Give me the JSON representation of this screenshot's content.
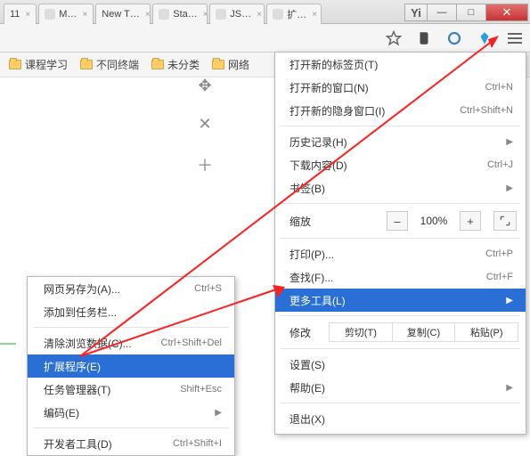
{
  "tabs": [
    {
      "label": "11"
    },
    {
      "label": "M…"
    },
    {
      "label": "New T…"
    },
    {
      "label": "Sta…"
    },
    {
      "label": "JS…"
    },
    {
      "label": "扩…"
    }
  ],
  "window": {
    "logo": "Yi",
    "min": "—",
    "max": "□",
    "close": "✕"
  },
  "bookmarks": [
    {
      "label": "课程学习"
    },
    {
      "label": "不同终端"
    },
    {
      "label": "未分类"
    },
    {
      "label": "网络"
    }
  ],
  "menu": {
    "new_tab": {
      "label": "打开新的标签页(T)",
      "sc": ""
    },
    "new_win": {
      "label": "打开新的窗口(N)",
      "sc": "Ctrl+N"
    },
    "incog": {
      "label": "打开新的隐身窗口(I)",
      "sc": "Ctrl+Shift+N"
    },
    "history": {
      "label": "历史记录(H)",
      "sc": ""
    },
    "downloads": {
      "label": "下载内容(D)",
      "sc": "Ctrl+J"
    },
    "bookmarks": {
      "label": "书签(B)",
      "sc": ""
    },
    "zoom": {
      "label": "缩放",
      "minus": "–",
      "val": "100%",
      "plus": "+"
    },
    "print": {
      "label": "打印(P)...",
      "sc": "Ctrl+P"
    },
    "find": {
      "label": "查找(F)...",
      "sc": "Ctrl+F"
    },
    "more_tools": {
      "label": "更多工具(L)",
      "sc": ""
    },
    "edit": {
      "label": "修改",
      "cut": "剪切(T)",
      "copy": "复制(C)",
      "paste": "粘贴(P)"
    },
    "settings": {
      "label": "设置(S)",
      "sc": ""
    },
    "help": {
      "label": "帮助(E)",
      "sc": ""
    },
    "exit": {
      "label": "退出(X)",
      "sc": ""
    }
  },
  "submenu": {
    "save_as": {
      "label": "网页另存为(A)...",
      "sc": "Ctrl+S"
    },
    "add_to": {
      "label": "添加到任务栏...",
      "sc": ""
    },
    "clear": {
      "label": "清除浏览数据(C)...",
      "sc": "Ctrl+Shift+Del"
    },
    "extensions": {
      "label": "扩展程序(E)",
      "sc": ""
    },
    "taskmgr": {
      "label": "任务管理器(T)",
      "sc": "Shift+Esc"
    },
    "encoding": {
      "label": "编码(E)",
      "sc": ""
    },
    "devtools": {
      "label": "开发者工具(D)",
      "sc": "Ctrl+Shift+I"
    }
  }
}
